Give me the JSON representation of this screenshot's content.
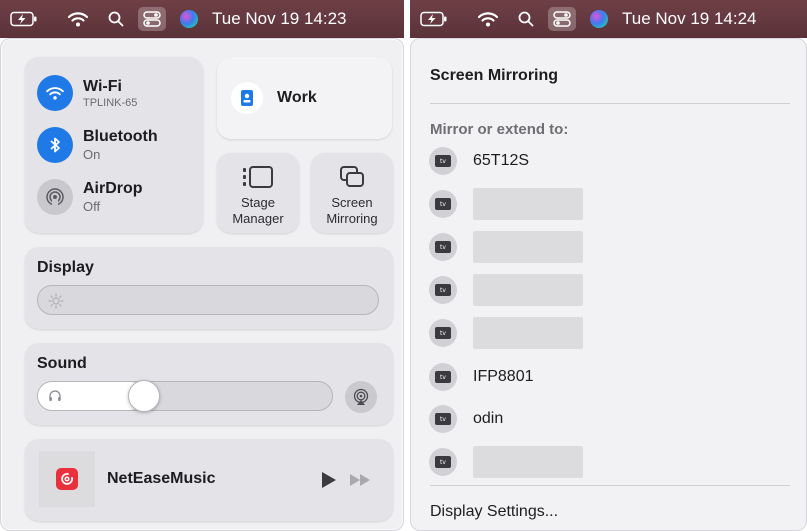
{
  "menubar_left": {
    "clock": "Tue Nov 19  14:23",
    "icons": [
      "battery-charging-icon",
      "wifi-icon",
      "search-icon",
      "control-center-icon",
      "siri-icon"
    ]
  },
  "menubar_right": {
    "clock": "Tue Nov 19  14:24",
    "icons": [
      "battery-charging-icon",
      "wifi-icon",
      "search-icon",
      "control-center-icon",
      "siri-icon"
    ]
  },
  "control_center": {
    "wifi": {
      "title": "Wi-Fi",
      "subtitle": "TPLINK-65",
      "enabled": true
    },
    "bluetooth": {
      "title": "Bluetooth",
      "subtitle": "On",
      "enabled": true
    },
    "airdrop": {
      "title": "AirDrop",
      "subtitle": "Off",
      "enabled": false
    },
    "focus": {
      "label": "Work"
    },
    "stage_manager": {
      "label_line1": "Stage",
      "label_line2": "Manager"
    },
    "screen_mirroring": {
      "label_line1": "Screen",
      "label_line2": "Mirroring"
    },
    "display": {
      "title": "Display",
      "brightness": 0.0
    },
    "sound": {
      "title": "Sound",
      "volume": 0.34
    },
    "now_playing": {
      "app": "NetEaseMusic"
    }
  },
  "mirror_panel": {
    "title": "Screen Mirroring",
    "subtitle": "Mirror or extend to:",
    "devices": [
      "65T12S",
      "",
      "",
      "",
      "",
      "IFP8801",
      "odin",
      ""
    ],
    "tv_badge": "tv",
    "footer": "Display Settings..."
  },
  "colors": {
    "menubar": "#5f373d",
    "accent_blue": "#1f7ae8",
    "netease_red": "#e8313d"
  }
}
